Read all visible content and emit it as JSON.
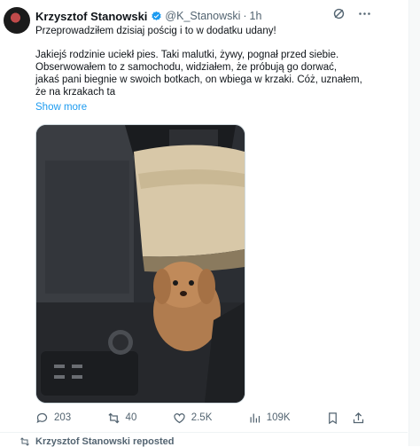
{
  "tweet": {
    "author_name": "Krzysztof Stanowski",
    "handle": "@K_Stanowski",
    "separator": "·",
    "time": "1h",
    "text_line1": "Przeprowadziłem dzisiaj pościg i to w dodatku udany!",
    "text_para2": "Jakiejś rodzinie uciekł pies. Taki malutki, żywy, pognał przed siebie. Obserwowałem to z samochodu, widziałem, że próbują go dorwać, jakaś pani biegnie w swoich botkach, on wbiega w krzaki. Cóż, uznałem, że na krzakach ta",
    "show_more": "Show more",
    "media_alt": "Small poodle dog sitting on car floor",
    "stats": {
      "replies": "203",
      "reposts": "40",
      "likes": "2.5K",
      "views": "109K"
    }
  },
  "next_item": {
    "repost_label": "Krzysztof Stanowski reposted"
  },
  "colors": {
    "accent": "#1d9bf0",
    "muted": "#536471",
    "text": "#0f1419",
    "verified": "#1d9bf0"
  }
}
